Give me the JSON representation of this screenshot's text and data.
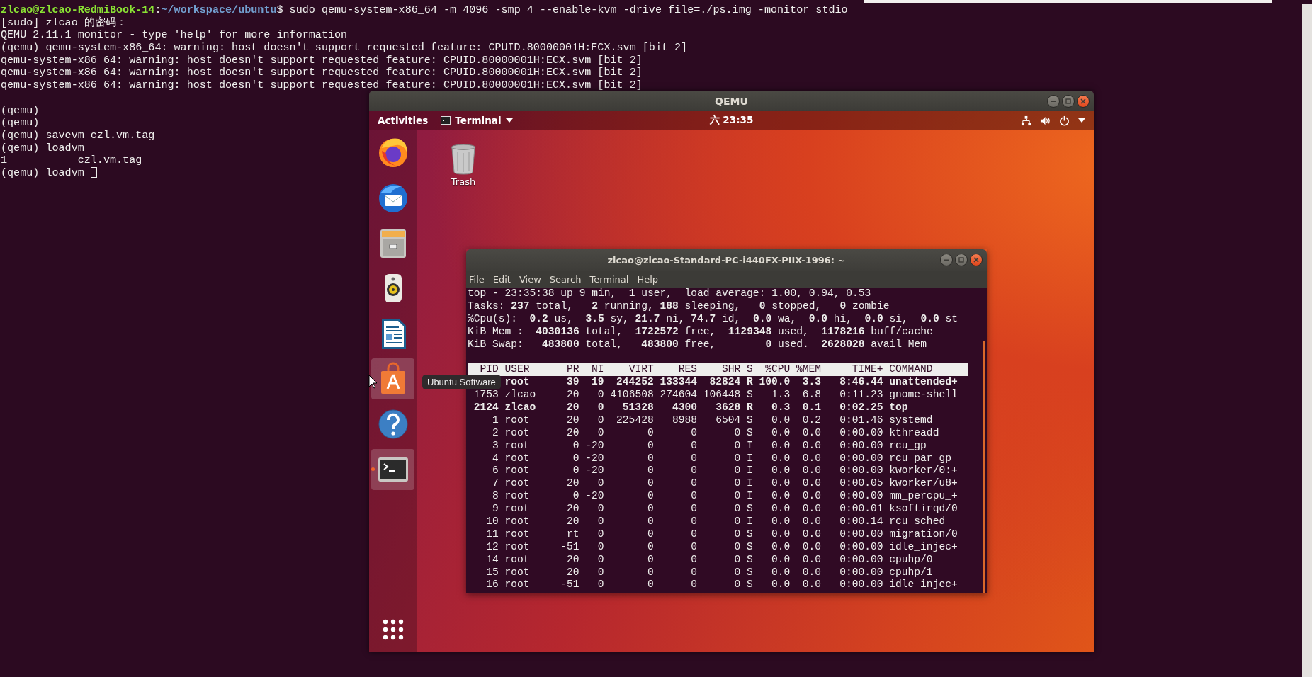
{
  "host_terminal": {
    "lines": [
      {
        "kind": "prompt",
        "segments": [
          {
            "kind": "user",
            "text": "zlcao@zlcao-RedmiBook-14"
          },
          {
            "kind": "separator",
            "text": ":"
          },
          {
            "kind": "path",
            "text": "~/workspace/ubuntu"
          },
          {
            "kind": "command",
            "text": "$ sudo qemu-system-x86_64 -m 4096 -smp 4 --enable-kvm -drive file=./ps.img -monitor stdio"
          }
        ]
      },
      {
        "kind": "text",
        "text": "[sudo] zlcao 的密码："
      },
      {
        "kind": "text",
        "text": "QEMU 2.11.1 monitor - type 'help' for more information"
      },
      {
        "kind": "text",
        "text": "(qemu) qemu-system-x86_64: warning: host doesn't support requested feature: CPUID.80000001H:ECX.svm [bit 2]"
      },
      {
        "kind": "text",
        "text": "qemu-system-x86_64: warning: host doesn't support requested feature: CPUID.80000001H:ECX.svm [bit 2]"
      },
      {
        "kind": "text",
        "text": "qemu-system-x86_64: warning: host doesn't support requested feature: CPUID.80000001H:ECX.svm [bit 2]"
      },
      {
        "kind": "text",
        "text": "qemu-system-x86_64: warning: host doesn't support requested feature: CPUID.80000001H:ECX.svm [bit 2]"
      },
      {
        "kind": "blank"
      },
      {
        "kind": "text",
        "text": "(qemu)"
      },
      {
        "kind": "text",
        "text": "(qemu)"
      },
      {
        "kind": "text",
        "text": "(qemu) savevm czl.vm.tag"
      },
      {
        "kind": "text",
        "text": "(qemu) loadvm"
      },
      {
        "kind": "text",
        "text": "1           czl.vm.tag"
      },
      {
        "kind": "input",
        "text": "(qemu) loadvm",
        "cursor": true
      }
    ]
  },
  "qemu_window": {
    "title": "QEMU",
    "top_bar": {
      "activities": "Activities",
      "app_menu": "Terminal",
      "clock": "六 23:35"
    },
    "dock": {
      "items": [
        {
          "kind": "browser",
          "highlighted": false,
          "running": false
        },
        {
          "kind": "mail",
          "highlighted": false,
          "running": false
        },
        {
          "kind": "files",
          "highlighted": false,
          "running": false
        },
        {
          "kind": "music",
          "highlighted": false,
          "running": false
        },
        {
          "kind": "writer",
          "highlighted": false,
          "running": false
        },
        {
          "kind": "software",
          "highlighted": true,
          "running": false
        },
        {
          "kind": "help",
          "highlighted": false,
          "running": false
        },
        {
          "kind": "terminal",
          "highlighted": true,
          "running": true
        }
      ],
      "tooltip": "Ubuntu Software"
    },
    "desktop_icons": [
      {
        "label": "Trash"
      }
    ],
    "terminal": {
      "title": "zlcao@zlcao-Standard-PC-i440FX-PIIX-1996: ~",
      "menu": [
        "File",
        "Edit",
        "View",
        "Search",
        "Terminal",
        "Help"
      ],
      "summary": [
        "top - 23:35:38 up 9 min,  1 user,  load average: 1.00, 0.94, 0.53",
        "Tasks: **237** total,   **2** running, **188** sleeping,   **0** stopped,   **0** zombie",
        "%Cpu(s):  **0.2** us,  **3.5** sy, **21.7** ni, **74.7** id,  **0.0** wa,  **0.0** hi,  **0.0** si,  **0.0** st",
        "KiB Mem :  **4030136** total,  **1722572** free,  **1129348** used,  **1178216** buff/cache",
        "KiB Swap:   **483800** total,   **483800** free,        **0** used.  **2628028** avail Mem"
      ],
      "columns": [
        "PID",
        "USER",
        "PR",
        "NI",
        "VIRT",
        "RES",
        "SHR",
        "S",
        "%CPU",
        "%MEM",
        "TIME+",
        "COMMAND"
      ],
      "rows": [
        {
          "bold": true,
          "cells": [
            null,
            "root",
            "39",
            "19",
            "244252",
            "133344",
            "82824",
            "R",
            "100.0",
            "3.3",
            "8:46.44",
            "unattended+"
          ]
        },
        {
          "bold": false,
          "cells": [
            "1753",
            "zlcao",
            "20",
            "0",
            "4106508",
            "274604",
            "106448",
            "S",
            "1.3",
            "6.8",
            "0:11.23",
            "gnome-shell"
          ]
        },
        {
          "bold": true,
          "cells": [
            "2124",
            "zlcao",
            "20",
            "0",
            "51328",
            "4300",
            "3628",
            "R",
            "0.3",
            "0.1",
            "0:02.25",
            "top"
          ]
        },
        {
          "bold": false,
          "cells": [
            "1",
            "root",
            "20",
            "0",
            "225428",
            "8988",
            "6504",
            "S",
            "0.0",
            "0.2",
            "0:01.46",
            "systemd"
          ]
        },
        {
          "bold": false,
          "cells": [
            "2",
            "root",
            "20",
            "0",
            "0",
            "0",
            "0",
            "S",
            "0.0",
            "0.0",
            "0:00.00",
            "kthreadd"
          ]
        },
        {
          "bold": false,
          "cells": [
            "3",
            "root",
            "0",
            "-20",
            "0",
            "0",
            "0",
            "I",
            "0.0",
            "0.0",
            "0:00.00",
            "rcu_gp"
          ]
        },
        {
          "bold": false,
          "cells": [
            "4",
            "root",
            "0",
            "-20",
            "0",
            "0",
            "0",
            "I",
            "0.0",
            "0.0",
            "0:00.00",
            "rcu_par_gp"
          ]
        },
        {
          "bold": false,
          "cells": [
            "6",
            "root",
            "0",
            "-20",
            "0",
            "0",
            "0",
            "I",
            "0.0",
            "0.0",
            "0:00.00",
            "kworker/0:+"
          ]
        },
        {
          "bold": false,
          "cells": [
            "7",
            "root",
            "20",
            "0",
            "0",
            "0",
            "0",
            "I",
            "0.0",
            "0.0",
            "0:00.05",
            "kworker/u8+"
          ]
        },
        {
          "bold": false,
          "cells": [
            "8",
            "root",
            "0",
            "-20",
            "0",
            "0",
            "0",
            "I",
            "0.0",
            "0.0",
            "0:00.00",
            "mm_percpu_+"
          ]
        },
        {
          "bold": false,
          "cells": [
            "9",
            "root",
            "20",
            "0",
            "0",
            "0",
            "0",
            "S",
            "0.0",
            "0.0",
            "0:00.01",
            "ksoftirqd/0"
          ]
        },
        {
          "bold": false,
          "cells": [
            "10",
            "root",
            "20",
            "0",
            "0",
            "0",
            "0",
            "I",
            "0.0",
            "0.0",
            "0:00.14",
            "rcu_sched"
          ]
        },
        {
          "bold": false,
          "cells": [
            "11",
            "root",
            "rt",
            "0",
            "0",
            "0",
            "0",
            "S",
            "0.0",
            "0.0",
            "0:00.00",
            "migration/0"
          ]
        },
        {
          "bold": false,
          "cells": [
            "12",
            "root",
            "-51",
            "0",
            "0",
            "0",
            "0",
            "S",
            "0.0",
            "0.0",
            "0:00.00",
            "idle_injec+"
          ]
        },
        {
          "bold": false,
          "cells": [
            "14",
            "root",
            "20",
            "0",
            "0",
            "0",
            "0",
            "S",
            "0.0",
            "0.0",
            "0:00.00",
            "cpuhp/0"
          ]
        },
        {
          "bold": false,
          "cells": [
            "15",
            "root",
            "20",
            "0",
            "0",
            "0",
            "0",
            "S",
            "0.0",
            "0.0",
            "0:00.00",
            "cpuhp/1"
          ]
        },
        {
          "bold": false,
          "cells": [
            "16",
            "root",
            "-51",
            "0",
            "0",
            "0",
            "0",
            "S",
            "0.0",
            "0.0",
            "0:00.00",
            "idle_injec+"
          ]
        }
      ]
    }
  }
}
